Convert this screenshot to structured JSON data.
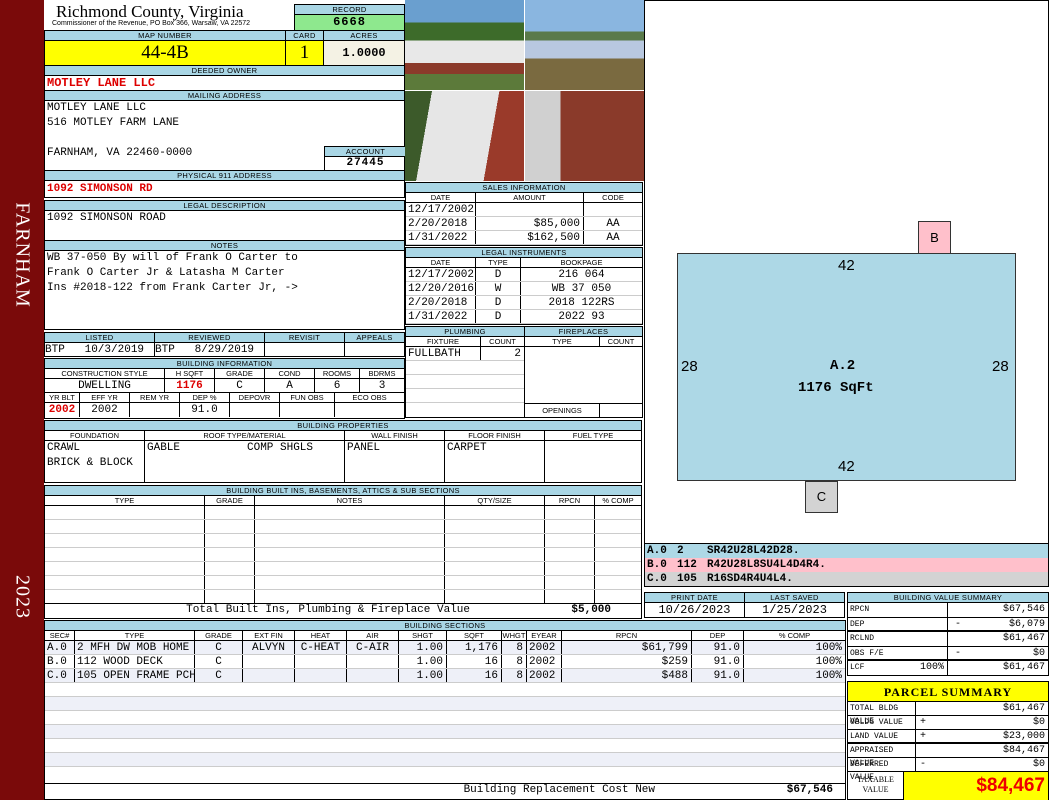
{
  "sidebar": {
    "town": "FARNHAM",
    "year": "2023"
  },
  "header": {
    "county": "Richmond County, Virginia",
    "address": "Commissioner of the Revenue, PO Box 366, Warsaw, VA 22572",
    "record_label": "RECORD",
    "record": "6668"
  },
  "parcel": {
    "map_label": "MAP NUMBER",
    "map": "44-4B",
    "card_label": "CARD",
    "card": "1",
    "acres_label": "ACRES",
    "acres": "1.0000"
  },
  "owner": {
    "label": "DEEDED OWNER",
    "name": "MOTLEY LANE LLC"
  },
  "mailing": {
    "label": "MAILING ADDRESS",
    "line1": "MOTLEY LANE LLC",
    "line2": "516 MOTLEY FARM LANE",
    "line3": "FARNHAM, VA 22460-0000",
    "account_label": "ACCOUNT",
    "account": "27445"
  },
  "physical": {
    "label": "PHYSICAL 911 ADDRESS",
    "value": "1092 SIMONSON RD"
  },
  "legal": {
    "label": "LEGAL DESCRIPTION",
    "value": "1092 SIMONSON ROAD"
  },
  "notes": {
    "label": "NOTES",
    "lines": [
      "WB 37-050 By will of Frank O Carter to",
      "Frank O Carter Jr & Latasha M Carter",
      "Ins #2018-122 from Frank Carter Jr, ->"
    ]
  },
  "listing": {
    "listed_label": "LISTED",
    "listed": "BTP   10/3/2019",
    "reviewed_label": "REVIEWED",
    "reviewed": "BTP   8/29/2019",
    "revisit_label": "REVISIT",
    "appeals_label": "APPEALS"
  },
  "building_info": {
    "label": "BUILDING INFORMATION",
    "cols1": [
      "CONSTRUCTION STYLE",
      "H SQFT",
      "GRADE",
      "COND",
      "ROOMS",
      "BDRMS"
    ],
    "vals1": [
      "DWELLING",
      "1176",
      "C",
      "A",
      "6",
      "3"
    ],
    "cols2": [
      "YR BLT",
      "EFF YR",
      "REM YR",
      "DEP %",
      "DEPOVR",
      "FUN OBS",
      "ECO OBS"
    ],
    "vals2": [
      "2002",
      "2002",
      "",
      "91.0",
      "",
      "",
      ""
    ]
  },
  "building_props": {
    "label": "BUILDING PROPERTIES",
    "cols": [
      "FOUNDATION",
      "ROOF TYPE/MATERIAL",
      "WALL FINISH",
      "FLOOR FINISH",
      "FUEL TYPE"
    ],
    "foundation": [
      "CRAWL",
      "BRICK & BLOCK"
    ],
    "roof_type": "GABLE",
    "roof_material": "COMP SHGLS",
    "wall": "PANEL",
    "floor": "CARPET",
    "fuel": ""
  },
  "builtins": {
    "label": "BUILDING BUILT INS, BASEMENTS, ATTICS & SUB SECTIONS",
    "cols": [
      "TYPE",
      "GRADE",
      "NOTES",
      "QTY/SIZE",
      "RPCN",
      "% COMP"
    ],
    "total_label": "Total Built Ins, Plumbing & Fireplace Value",
    "total": "$5,000"
  },
  "sections": {
    "label": "BUILDING SECTIONS",
    "cols": [
      "SEC#",
      "TYPE",
      "GRADE",
      "EXT FIN",
      "HEAT",
      "AIR",
      "SHGT",
      "SQFT",
      "WHGT",
      "EYEAR",
      "RPCN",
      "DEP",
      "% COMP"
    ],
    "rows": [
      [
        "A.0",
        "  2 MFH DW MOB HOME",
        "C",
        "ALVYN",
        "C-HEAT",
        "C-AIR",
        "1.00",
        "1,176",
        "8",
        "2002",
        "$61,799",
        "91.0",
        "100%"
      ],
      [
        "B.0",
        "112 WOOD DECK",
        "C",
        "",
        "",
        "",
        "1.00",
        "16",
        "8",
        "2002",
        "$259",
        "91.0",
        "100%"
      ],
      [
        "C.0",
        "105 OPEN FRAME PCH",
        "C",
        "",
        "",
        "",
        "1.00",
        "16",
        "8",
        "2002",
        "$488",
        "91.0",
        "100%"
      ]
    ],
    "rcn_label": "Building Replacement Cost New",
    "rcn": "$67,546"
  },
  "sales": {
    "label": "SALES INFORMATION",
    "cols": [
      "DATE",
      "AMOUNT",
      "CODE"
    ],
    "rows": [
      [
        "12/17/2002",
        "",
        ""
      ],
      [
        "2/20/2018",
        "$85,000",
        "AA"
      ],
      [
        "1/31/2022",
        "$162,500",
        "AA"
      ]
    ]
  },
  "instruments": {
    "label": "LEGAL INSTRUMENTS",
    "cols": [
      "DATE",
      "TYPE",
      "BOOKPAGE"
    ],
    "rows": [
      [
        "12/17/2002",
        "D",
        "216 064"
      ],
      [
        "12/20/2016",
        "W",
        "WB 37 050"
      ],
      [
        "2/20/2018",
        "D",
        "2018 122RS"
      ],
      [
        "1/31/2022",
        "D",
        "2022 93"
      ]
    ]
  },
  "plumbing": {
    "label": "PLUMBING",
    "cols": [
      "FIXTURE",
      "COUNT"
    ],
    "rows": [
      [
        "FULLBATH",
        "2"
      ]
    ]
  },
  "fireplaces": {
    "label": "FIREPLACES",
    "cols": [
      "TYPE",
      "COUNT"
    ],
    "openings_label": "OPENINGS"
  },
  "sketch": {
    "top": "42",
    "bottom": "42",
    "left": "28",
    "right": "28",
    "area_label": "A.2",
    "area": "1176 SqFt",
    "b": "B",
    "c": "C",
    "legend": [
      [
        "A.0",
        "2",
        "SR42U28L42D28."
      ],
      [
        "B.0",
        "112",
        "R42U28L8SU4L4D4R4."
      ],
      [
        "C.0",
        "105",
        "R16SD4R4U4L4."
      ]
    ]
  },
  "dates": {
    "print_label": "PRINT DATE",
    "print": "10/26/2023",
    "saved_label": "LAST SAVED",
    "saved": "1/25/2023"
  },
  "value_summary": {
    "label": "BUILDING VALUE SUMMARY",
    "rows": [
      [
        "RPCN",
        "",
        "",
        "$67,546"
      ],
      [
        "DEP",
        "",
        "-",
        "$6,079"
      ],
      [
        "RCLND",
        "",
        "",
        "$61,467"
      ],
      [
        "OBS F/E",
        "",
        "-",
        "$0"
      ],
      [
        "LCF",
        "100%",
        "",
        "$61,467"
      ]
    ]
  },
  "parcel_summary": {
    "label": "PARCEL SUMMARY",
    "rows": [
      [
        "TOTAL BLDG VALUE",
        "",
        "$61,467"
      ],
      [
        "OBLDG VALUE",
        "+",
        "$0"
      ],
      [
        "LAND VALUE",
        "+",
        "$23,000"
      ],
      [
        "APPRAISED VALUE",
        "",
        "$84,467"
      ],
      [
        "DEFERRED VALUE",
        "-",
        "$0"
      ]
    ],
    "taxable_label": "TAXABLE VALUE",
    "taxable": "$84,467"
  },
  "colors": {
    "header": "#a9d6e5",
    "sidebar": "#7a0a0a",
    "highlight": "#ffff00",
    "pink": "#ffc0cb"
  }
}
